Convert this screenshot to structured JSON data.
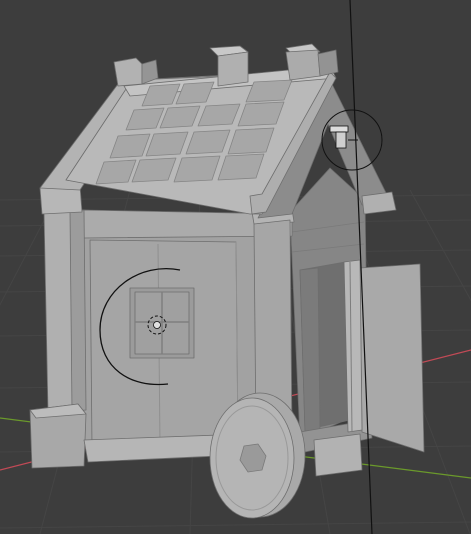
{
  "app": {
    "view": "3D Viewport",
    "background_color": "#3d3d3d",
    "grid_color": "#454545",
    "axis_x_color": "#c24a56",
    "axis_y_color": "#6b9a2b"
  },
  "scene": {
    "object": "house-cart-model",
    "object_color": "#9a9a9a",
    "shading": "solid",
    "widgets": [
      "object-origin-icon",
      "light-gizmo-icon",
      "camera-frustum-line",
      "rotation-arc"
    ]
  }
}
